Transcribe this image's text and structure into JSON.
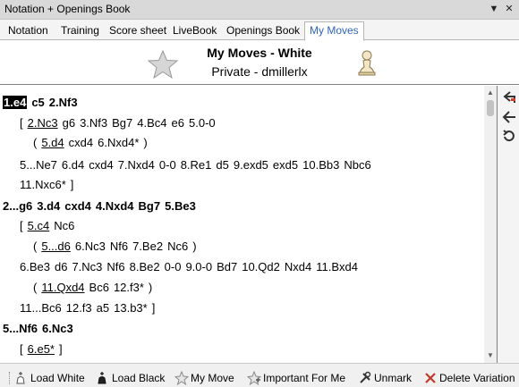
{
  "window": {
    "title": "Notation + Openings Book"
  },
  "tabs": [
    {
      "label": "Notation"
    },
    {
      "label": "Training"
    },
    {
      "label": "Score sheet"
    },
    {
      "label": "LiveBook"
    },
    {
      "label": "Openings Book"
    },
    {
      "label": "My Moves"
    }
  ],
  "active_tab": "My Moves",
  "header": {
    "title": "My Moves - White",
    "subtitle": "Private - dmillerlx"
  },
  "moves": {
    "line1": [
      "1.e4",
      "c5",
      "2.Nf3"
    ],
    "line2": [
      "[",
      "2.Nc3",
      "g6",
      "3.Nf3",
      "Bg7",
      "4.Bc4",
      "e6",
      "5.0-0"
    ],
    "line3": [
      "(",
      "5.d4",
      "cxd4",
      "6.Nxd4*",
      ")"
    ],
    "line4": [
      "5...Ne7",
      "6.d4",
      "cxd4",
      "7.Nxd4",
      "0-0",
      "8.Re1",
      "d5",
      "9.exd5",
      "exd5",
      "10.Bb3",
      "Nbc6"
    ],
    "line5": [
      "11.Nxc6*",
      "]"
    ],
    "line6": [
      "2...g6",
      "3.d4",
      "cxd4",
      "4.Nxd4",
      "Bg7",
      "5.Be3"
    ],
    "line7": [
      "[",
      "5.c4",
      "Nc6"
    ],
    "line8": [
      "(",
      "5...d6",
      "6.Nc3",
      "Nf6",
      "7.Be2",
      "Nc6",
      ")"
    ],
    "line9": [
      "6.Be3",
      "d6",
      "7.Nc3",
      "Nf6",
      "8.Be2",
      "0-0",
      "9.0-0",
      "Bd7",
      "10.Qd2",
      "Nxd4",
      "11.Bxd4"
    ],
    "line10": [
      "(",
      "11.Qxd4",
      "Bc6",
      "12.f3*",
      ")"
    ],
    "line11": [
      "11...Bc6",
      "12.f3",
      "a5",
      "13.b3*",
      "]"
    ],
    "line12": [
      "5...Nf6",
      "6.Nc3"
    ],
    "line13": [
      "[",
      "6.e5*",
      "]"
    ]
  },
  "bottom_toolbar": {
    "load_white": "Load White",
    "load_black": "Load Black",
    "my_move": "My Move",
    "important_for_me": "Important For Me",
    "unmark": "Unmark",
    "delete_variation": "Delete Variation"
  },
  "colors": {
    "active_tab_text": "#2f64b6",
    "highlight": "#000000",
    "delete_icon": "#c0392b"
  },
  "icons": [
    "star-icon",
    "pawn-icon",
    "promote-variation-icon",
    "arrow-left-icon",
    "undo-icon",
    "king-icon",
    "wrench-icon",
    "x-icon"
  ]
}
